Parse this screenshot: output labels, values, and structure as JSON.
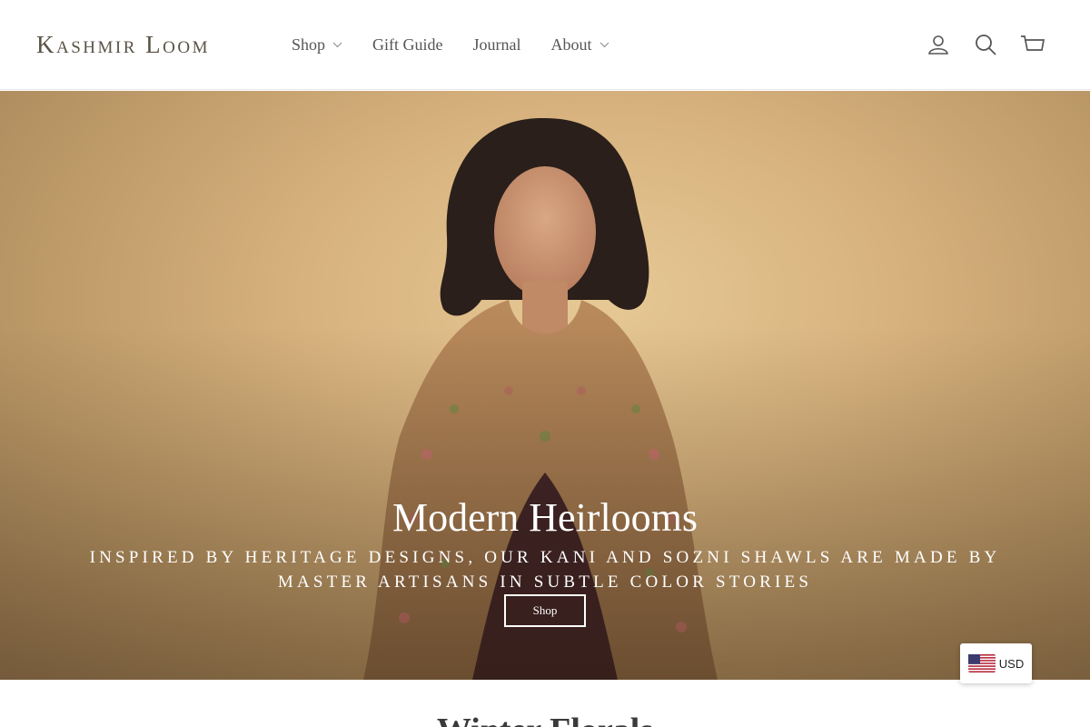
{
  "header": {
    "logo": "Kashmir Loom",
    "nav": [
      {
        "label": "Shop",
        "has_dropdown": true
      },
      {
        "label": "Gift Guide",
        "has_dropdown": false
      },
      {
        "label": "Journal",
        "has_dropdown": false
      },
      {
        "label": "About",
        "has_dropdown": true
      }
    ],
    "icons": [
      "account-icon",
      "search-icon",
      "cart-icon"
    ]
  },
  "hero": {
    "title": "Modern Heirlooms",
    "subtitle": "Inspired by heritage designs, our Kani and Sozni shawls are made by master artisans in subtle color stories",
    "button_label": "Shop"
  },
  "currency": {
    "code": "USD",
    "flag": "us-flag-icon"
  },
  "next_section": {
    "heading": "Winter Florals"
  },
  "colors": {
    "accent_text": "#5a5246",
    "hero_bg": "#d7b27e",
    "white": "#ffffff"
  }
}
